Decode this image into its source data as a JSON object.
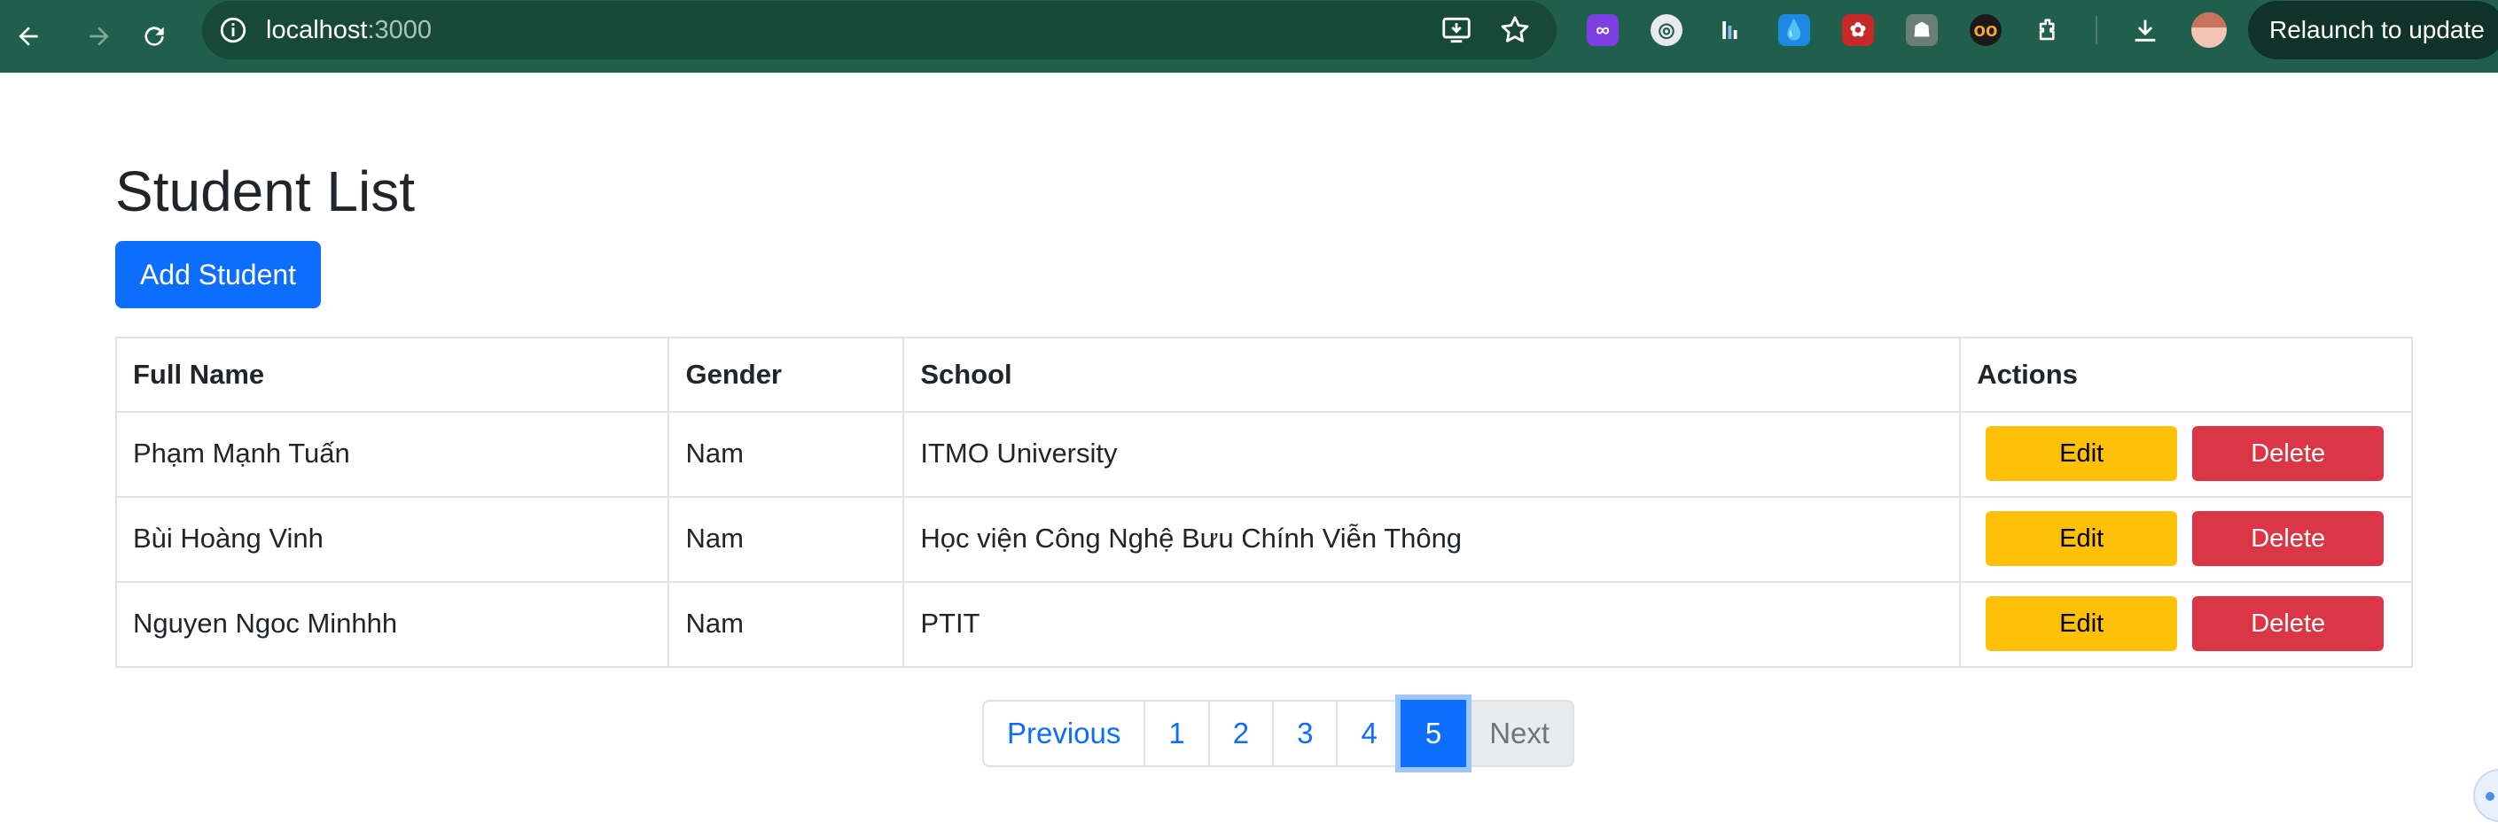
{
  "browser": {
    "url_host": "localhost",
    "url_port": ":3000",
    "relaunch_label": "Relaunch to update",
    "icons": [
      "back-arrow-icon",
      "forward-arrow-icon",
      "reload-icon",
      "site-info-icon",
      "install-app-icon",
      "bookmark-star-icon",
      "extensions-puzzle-icon",
      "download-icon"
    ],
    "extensions": [
      {
        "name": "extension-purple-icon",
        "color": "#7b3fe4"
      },
      {
        "name": "extension-globe-icon",
        "color": "#e8eaed"
      },
      {
        "name": "extension-bars-icon",
        "color": "#2f6fe0"
      },
      {
        "name": "extension-drop-icon",
        "color": "#1e88e5"
      },
      {
        "name": "extension-red-icon",
        "color": "#c62828"
      },
      {
        "name": "extension-robot-icon",
        "color": "#6b7f78"
      },
      {
        "name": "extension-eyes-icon",
        "color": "#f9a825"
      }
    ]
  },
  "page": {
    "title": "Student List",
    "add_button": "Add Student"
  },
  "table": {
    "headers": [
      "Full Name",
      "Gender",
      "School",
      "Actions"
    ],
    "rows": [
      {
        "name": "Phạm Mạnh Tuấn",
        "gender": "Nam",
        "school": "ITMO University"
      },
      {
        "name": "Bùi Hoàng Vinh",
        "gender": "Nam",
        "school": "Học viện Công Nghệ Bưu Chính Viễn Thông"
      },
      {
        "name": "Nguyen Ngoc Minhhh",
        "gender": "Nam",
        "school": "PTIT"
      }
    ],
    "edit_label": "Edit",
    "delete_label": "Delete"
  },
  "pagination": {
    "previous": "Previous",
    "pages": [
      "1",
      "2",
      "3",
      "4",
      "5"
    ],
    "active_page": "5",
    "next": "Next"
  },
  "colors": {
    "primary": "#0d6efd",
    "edit": "#ffc107",
    "delete": "#dc3545",
    "chrome_bg": "#1f5f4b"
  }
}
